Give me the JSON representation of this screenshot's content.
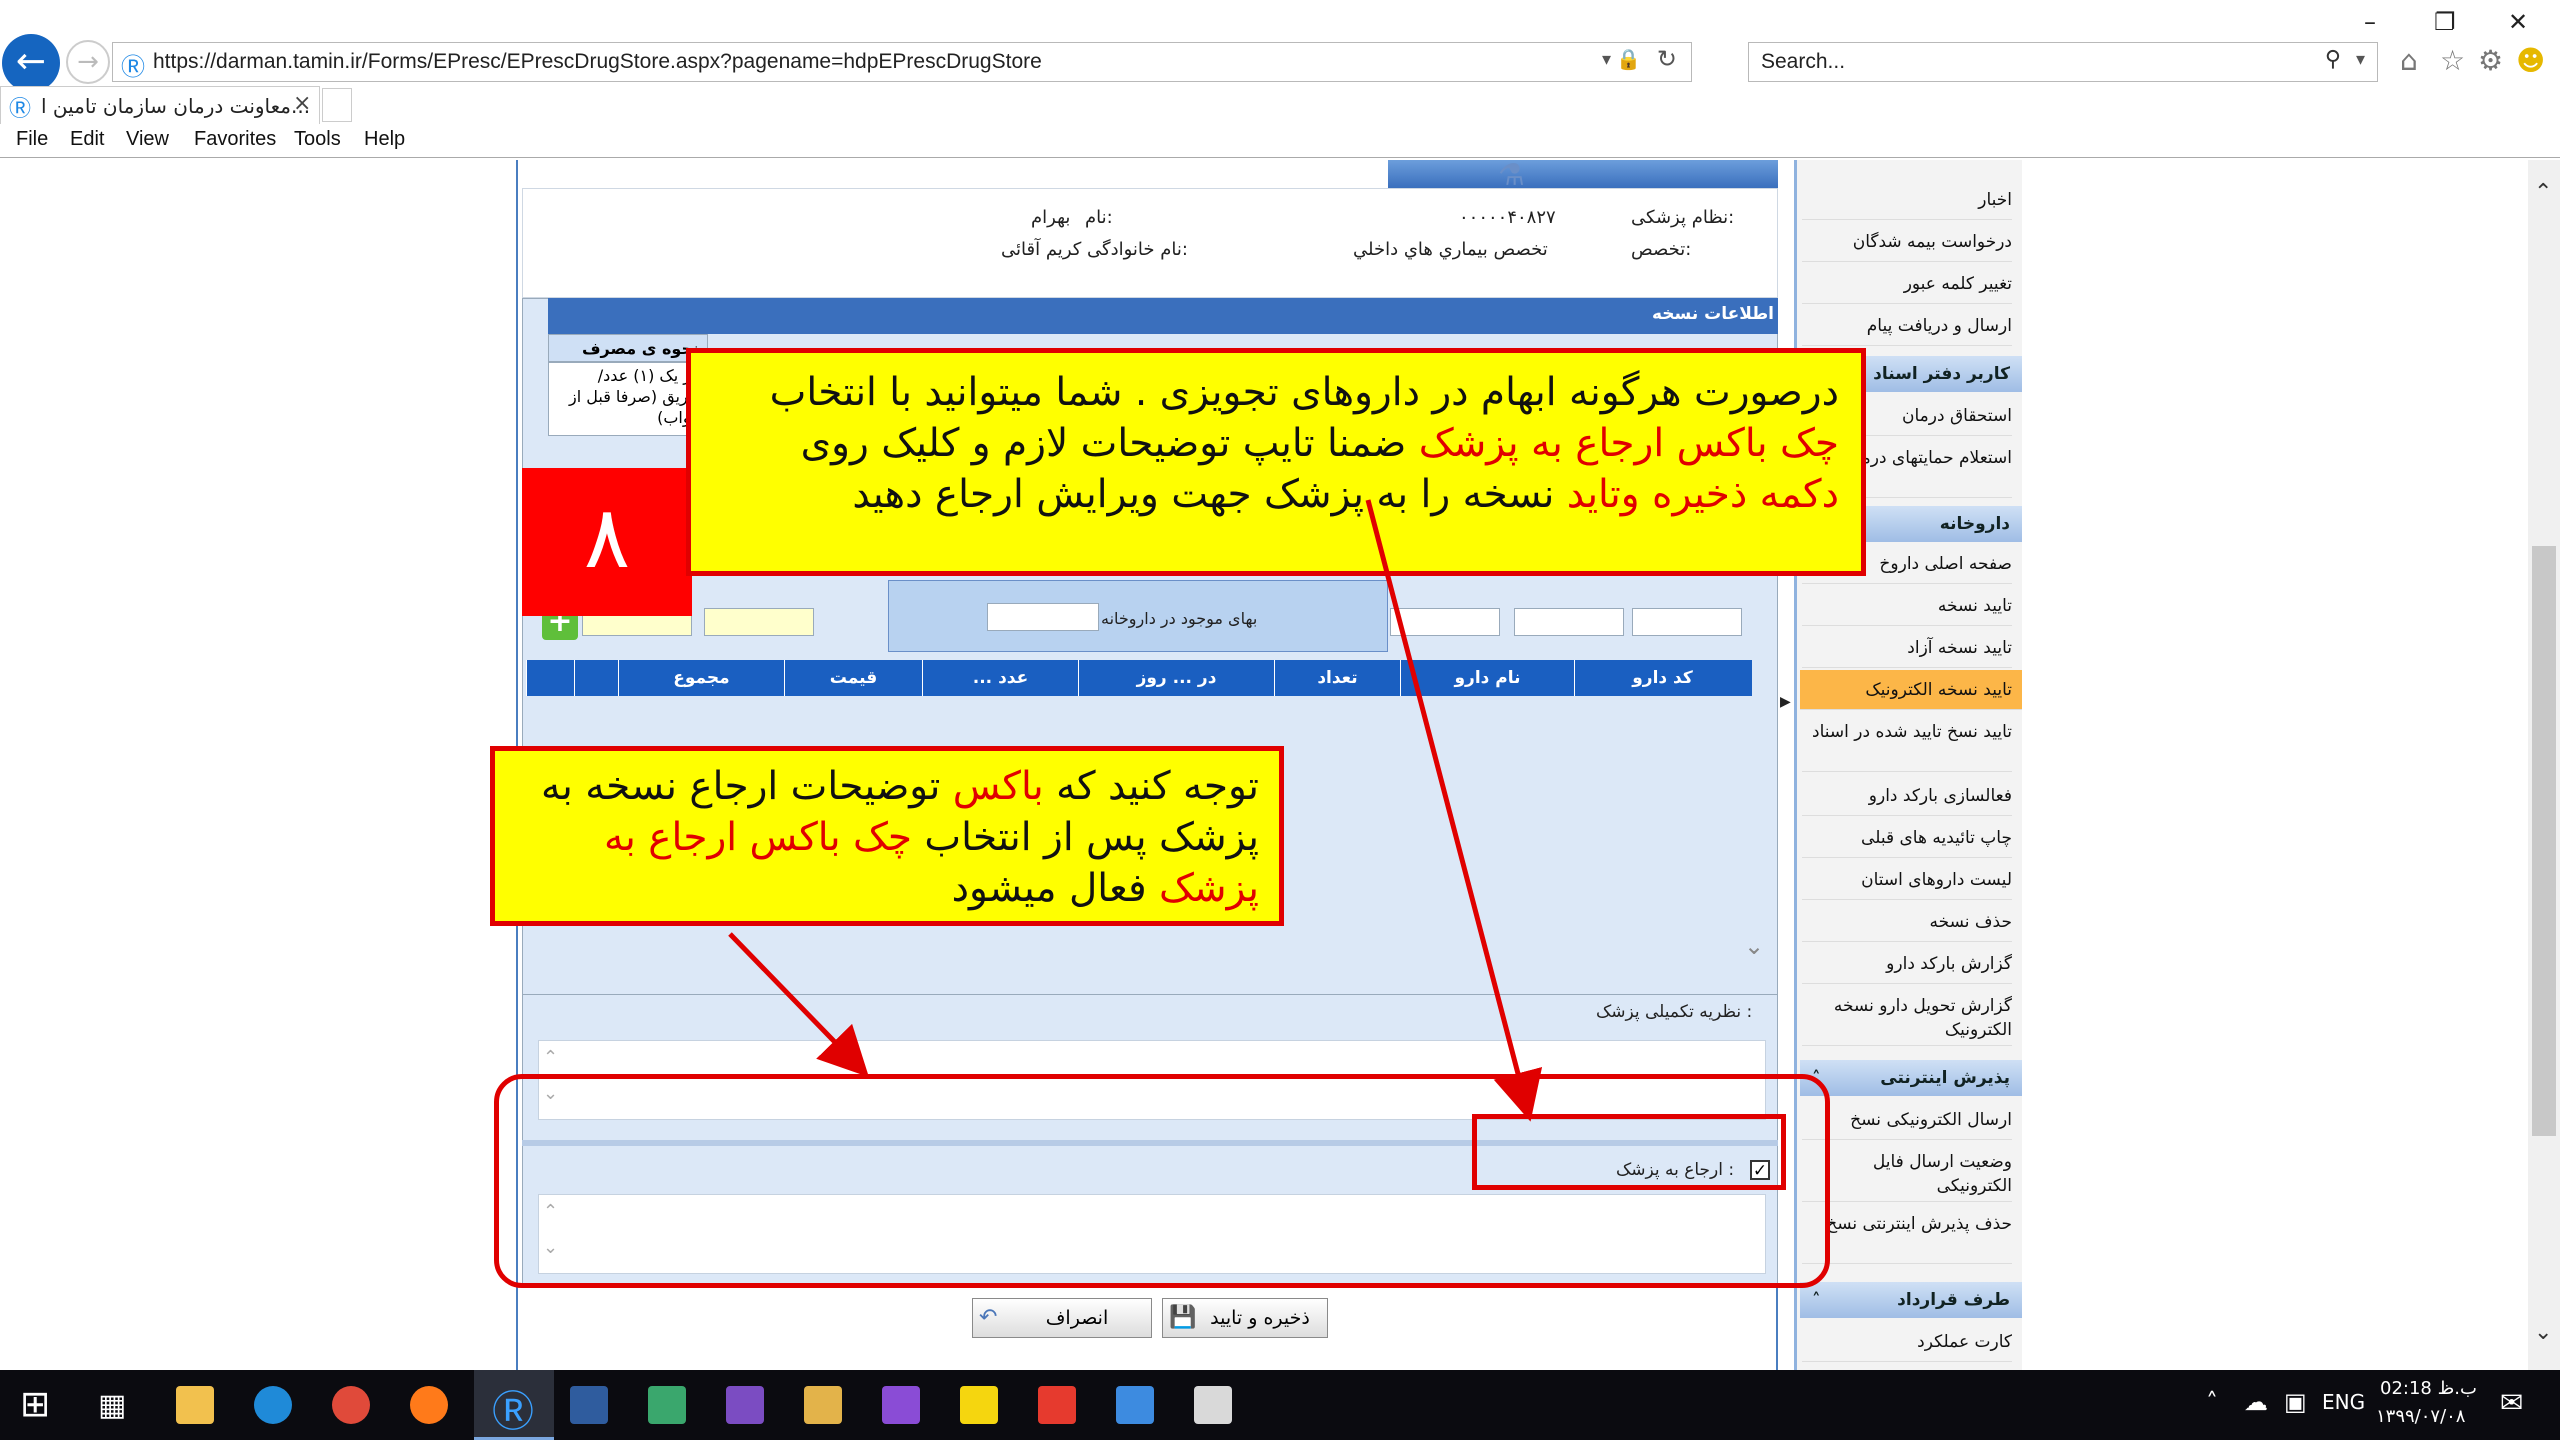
{
  "browser": {
    "url": "https://darman.tamin.ir/Forms/EPresc/EPrescDrugStore.aspx?pagename=hdpEPrescDrugStore",
    "search_placeholder": "Search...",
    "tab_title": "معاونت درمان سازمان تامین ا...",
    "menu": [
      "File",
      "Edit",
      "View",
      "Favorites",
      "Tools",
      "Help"
    ]
  },
  "doctor": {
    "name_label": "نام:",
    "name_value": "بهرام",
    "family_label": "نام خانوادگی:",
    "family_value": "کریم آقائی",
    "code_label": "نظام پزشکی:",
    "code_value": "۰۰۰۰۰۴۰۸۲۷",
    "specialty_label": "تخصص:",
    "specialty_value": "تخصص بيماري هاي داخلي"
  },
  "prescription_header": "اطلاعات نسخه",
  "usage_col": "نحوه ی مصرف",
  "usage_text": "ایر یک (۱) عدد/ تزریق (صرفا قبل از خواب)",
  "price_label": "بهای موجود در داروخانه",
  "table_headers": [
    "کد دارو",
    "نام دارو",
    "تعداد",
    "در ... روز",
    "... عدد",
    "قیمت",
    "مجموع"
  ],
  "comment_label": "نظریه تکمیلی پزشک :",
  "refer_label": "ارجاع به پزشک :",
  "buttons": {
    "save": "ذخیره و تایید",
    "cancel": "انصراف"
  },
  "sidebar": {
    "items_top": [
      "اخبار",
      "درخواست بیمه شدگان",
      "تغییر کلمه عبور",
      "ارسال و دریافت پیام"
    ],
    "section1": "کاربر دفتر اسناد",
    "items1": [
      "استحقاق درمان",
      "استعلام حمایتهای درمانی"
    ],
    "section2": "داروخانه",
    "items2": [
      "صفحه اصلی داروخ",
      "تایید نسخه",
      "تایید نسخه آزاد",
      "تایید نسخه الکترونیک",
      "تایید نسخ تایید شده در اسناد",
      "فعالسازی بارکد دارو",
      "چاپ تائیدیه های قبلی",
      "لیست داروهای استان",
      "حذف نسخه",
      "گزارش بارکد دارو",
      "گزارش تحویل دارو نسخه الکترونیک"
    ],
    "section3": "پذیرش اینترنتی",
    "items3": [
      "ارسال الکترونیکی نسخ",
      "وضعیت ارسال فایل الکترونیکی",
      "حذف پذیرش اینترنتی نسخ"
    ],
    "section4": "طرف قرارداد",
    "items4": [
      "کارت عملکرد"
    ]
  },
  "annotations": {
    "step_number": "۸",
    "callout1": {
      "p1": "درصورت هرگونه ابهام در داروهای تجویزی . شما میتوانید با انتخاب ",
      "h1": "چک باکس",
      "p2": " ",
      "h2": "ارجاع به پزشک",
      "p3": " ضمنا تایپ توضیحات لازم و کلیک روی ",
      "h3": "دکمه ذخیره وتاید",
      "p4": " نسخه را به پزشک جهت ویرایش ارجاع دهید"
    },
    "callout2": {
      "p1": "توجه کنید که ",
      "h1": "باکس",
      "p2": " توضیحات ارجاع نسخه به پزشک پس از انتخاب ",
      "h2": "چک باکس ارجاع به پزشک",
      "p3": " فعال میشود"
    }
  },
  "taskbar": {
    "lang": "ENG",
    "time": "02:18 ب.ظ",
    "date": "۱۳۹۹/۰۷/۰۸"
  }
}
